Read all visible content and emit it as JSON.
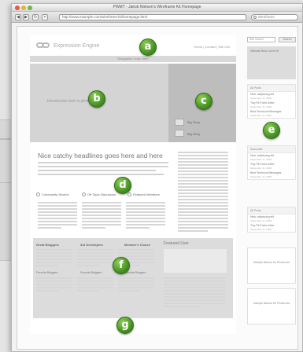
{
  "browser": {
    "window_title": "PWMT - Jakob Nielsen's Wireframe Kit Homepage",
    "url": "http://www.example.com/wireframe-kit/homepage.html",
    "search_placeholder": "Wireframe",
    "nav_back": "◀",
    "nav_forward": "▶",
    "nav_reload": "↻",
    "nav_plus": "+"
  },
  "page": {
    "site_name": "Expression Engine",
    "top_nav": "Home  |  Contact  |  Site Info",
    "navbar_label": "Navigation Links Here",
    "hero_text": "Introduction text or photo gallery",
    "feature_items": [
      "Big Story",
      "Big Story"
    ],
    "headline": "Nice catchy headlines goes here and here",
    "column_heads": [
      "Community Section",
      "Off Topic Discussion",
      "Featured Members"
    ],
    "footer_columns": [
      {
        "title": "Great Bloggers",
        "sub": "Favorite Bloggers"
      },
      {
        "title": "3rd Developers",
        "sub": "Favorite Bloggers"
      },
      {
        "title": "Member's Choice",
        "sub": "Favorite Bloggers"
      }
    ],
    "featured_user_title": "Featured User"
  },
  "sidebar": {
    "search_placeholder": "Site Search",
    "search_button": "Search",
    "ad_text": "Ultimate Best Lorem IS",
    "boxes": [
      {
        "head": "All Posts",
        "items": [
          "New: adipiscing elit",
          "Tiny Fit Fonts Inline",
          "Best Technical Messages"
        ]
      },
      {
        "head": "Subscribe",
        "items": [
          "New: adipiscing elit",
          "Tiny Fit Fonts Inline",
          "Best Technical Messages"
        ]
      },
      {
        "head": "All Posts",
        "items": [
          "New: adipiscing elit",
          "Tiny Fit Fonts Inline"
        ]
      }
    ],
    "item_date": "September 11, 2008",
    "promos": [
      "Sample Banner for Photos Ad",
      "Sample Banner for Photos Ad"
    ]
  },
  "markers": {
    "a": "a",
    "b": "b",
    "c": "c",
    "d": "d",
    "e": "e",
    "f": "f",
    "g": "g"
  },
  "colors": {
    "marker_green": "#4f9d2a",
    "hero_gray": "#d4d4d4",
    "feature_gray": "#bdbdbd",
    "footer_gray": "#dcdcdc"
  }
}
